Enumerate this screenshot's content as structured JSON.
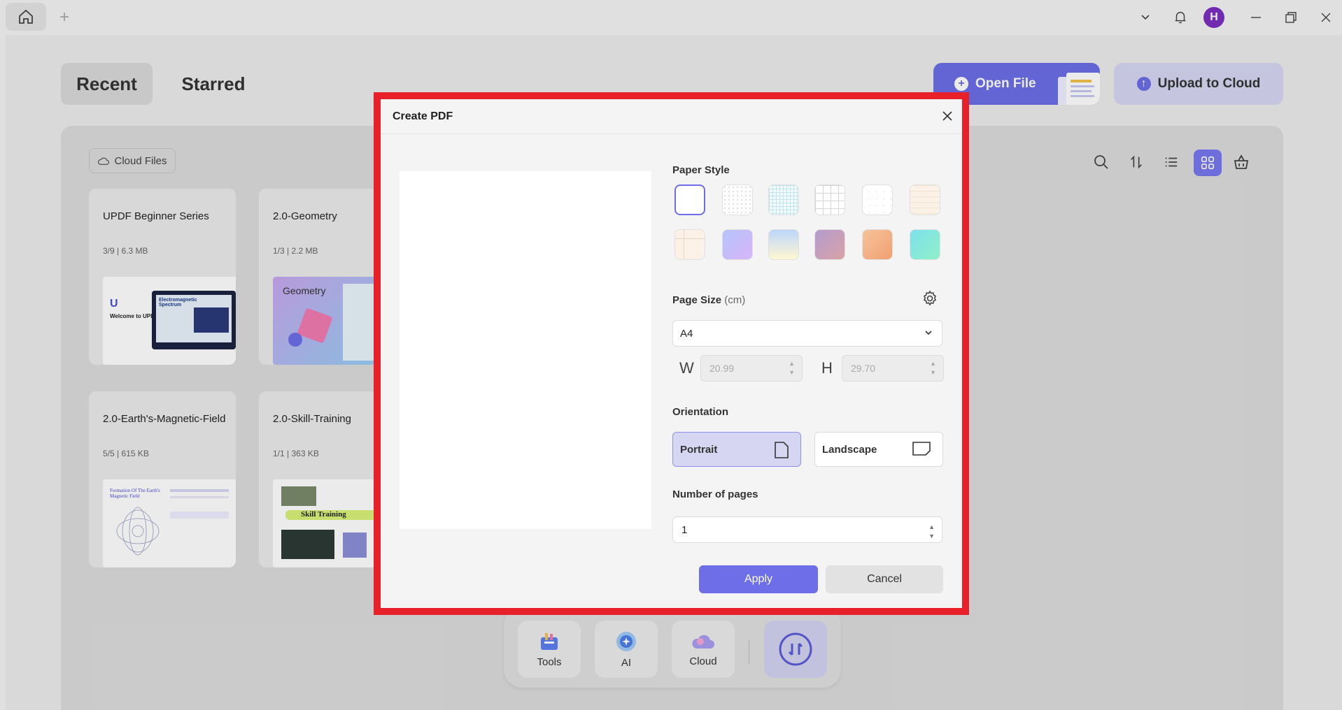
{
  "titlebar": {
    "icons": [
      "home-icon",
      "plus-icon",
      "chevron-down-icon",
      "bell-icon",
      "minimize-icon",
      "restore-icon",
      "close-icon"
    ],
    "avatar_letter": "H",
    "avatar_color": "#7b2fbf"
  },
  "tabs": {
    "recent": "Recent",
    "starred": "Starred"
  },
  "actions": {
    "open_file": "Open File",
    "upload_cloud": "Upload to Cloud"
  },
  "panel": {
    "cloud_files": "Cloud Files",
    "toolbar_icons": [
      "search-icon",
      "sort-icon",
      "list-view-icon",
      "grid-view-icon",
      "basket-icon"
    ]
  },
  "files": [
    {
      "title": "UPDF Beginner Series",
      "meta": "3/9 | 6.3 MB"
    },
    {
      "title": "2.0-Geometry",
      "meta": "1/3 | 2.2 MB"
    },
    {
      "title": "2.0-Earth's-Magnetic-Field",
      "meta": "5/5 | 615 KB"
    },
    {
      "title": "2.0-Skill-Training",
      "meta": "1/1 | 363 KB"
    }
  ],
  "thumb_text": {
    "welcome": "Welcome to UPDF",
    "electromag": "Electromagnetic Spectrum",
    "geometry": "Geometry",
    "formation": "Formation Of The Earth's Magnetic Field",
    "skill": "Skill Training"
  },
  "dock": {
    "tools": "Tools",
    "ai": "AI",
    "cloud": "Cloud"
  },
  "dialog": {
    "title": "Create PDF",
    "paper_style": "Paper Style",
    "page_size": "Page Size",
    "page_size_unit": "(cm)",
    "page_size_value": "A4",
    "w_label": "W",
    "w_value": "20.99",
    "h_label": "H",
    "h_value": "29.70",
    "orientation": "Orientation",
    "portrait": "Portrait",
    "landscape": "Landscape",
    "number_of_pages": "Number of pages",
    "pages_value": "1",
    "apply": "Apply",
    "cancel": "Cancel"
  },
  "colors": {
    "accent": "#6d6ee8",
    "highlight": "#e8202a"
  }
}
